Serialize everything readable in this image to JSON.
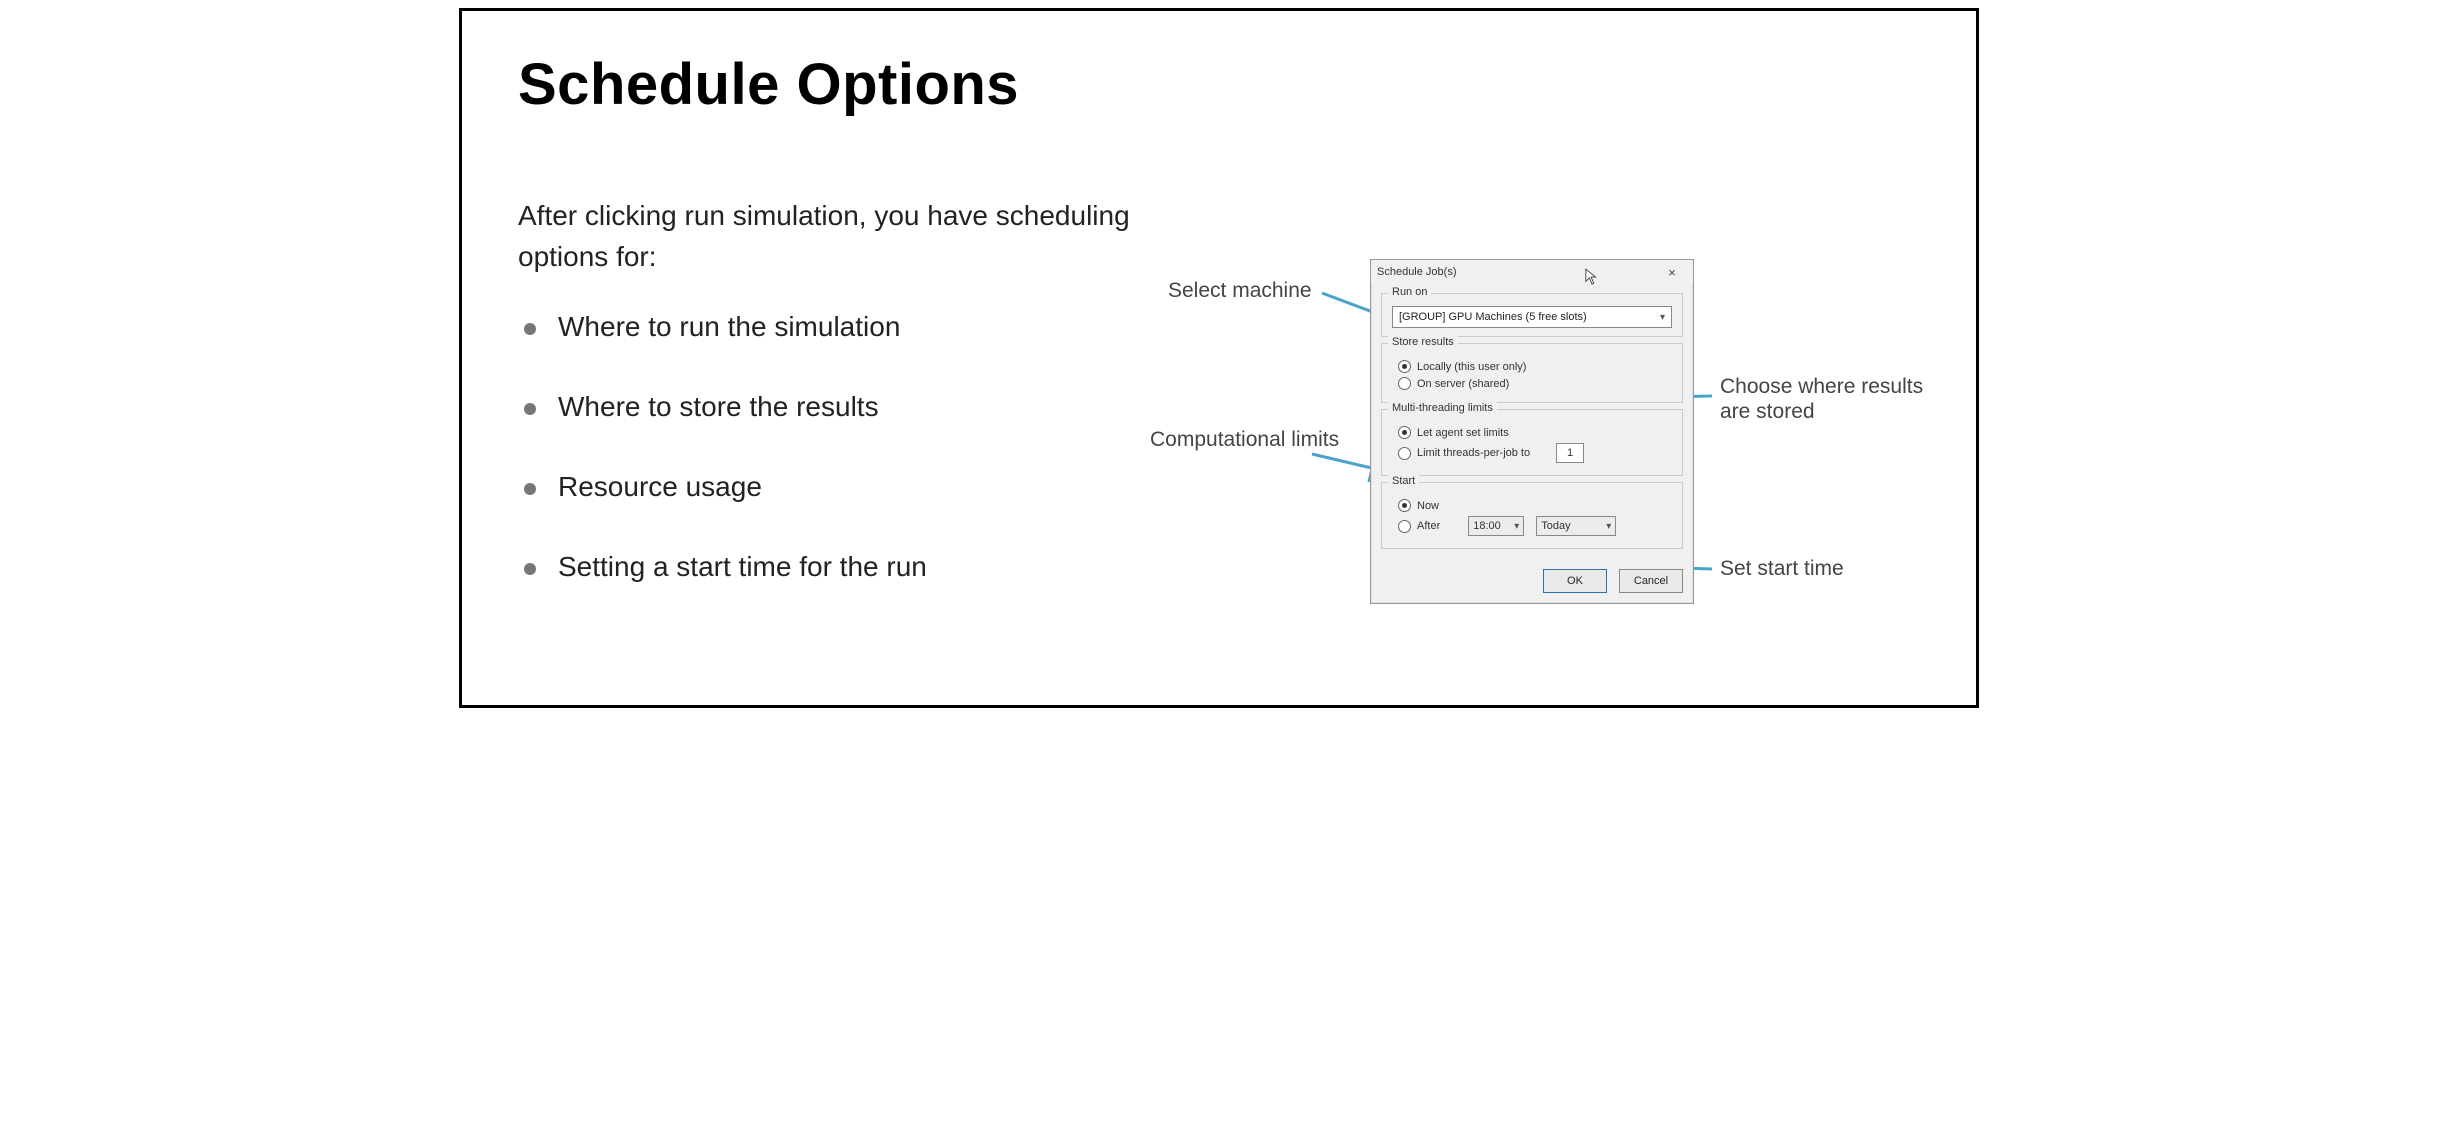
{
  "title": "Schedule Options",
  "intro": "After clicking run simulation, you have scheduling options for:",
  "bullets": [
    "Where to run the simulation",
    "Where to store the results",
    "Resource usage",
    "Setting a start time for the run"
  ],
  "callouts": {
    "select_machine": "Select machine",
    "results_stored": "Choose where results are stored",
    "comp_limits": "Computational limits",
    "start_time": "Set start time"
  },
  "dialog": {
    "title": "Schedule Job(s)",
    "close": "×",
    "groups": {
      "run_on": {
        "legend": "Run on",
        "select_value": "[GROUP] GPU Machines (5 free slots)"
      },
      "store_results": {
        "legend": "Store results",
        "opt_local": "Locally (this user only)",
        "opt_server": "On server (shared)",
        "selected": "local"
      },
      "threads": {
        "legend": "Multi-threading limits",
        "opt_agent": "Let agent set limits",
        "opt_limit": "Limit threads-per-job to",
        "limit_value": "1",
        "selected": "agent"
      },
      "start": {
        "legend": "Start",
        "opt_now": "Now",
        "opt_after": "After",
        "time": "18:00",
        "day": "Today",
        "selected": "now"
      }
    },
    "buttons": {
      "ok": "OK",
      "cancel": "Cancel"
    }
  },
  "colors": {
    "arrow": "#4aa3c9"
  }
}
